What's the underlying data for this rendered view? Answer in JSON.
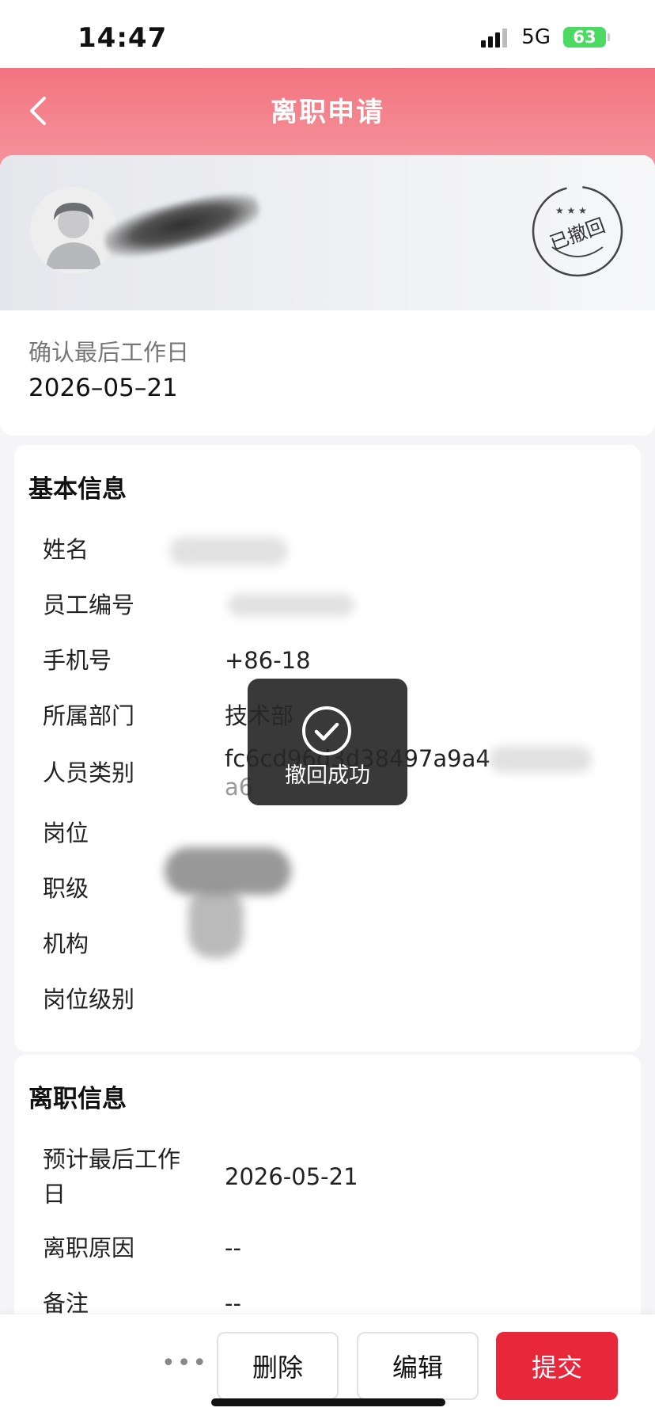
{
  "status_bar": {
    "time": "14:47",
    "network": "5G",
    "battery": "63"
  },
  "header": {
    "title": "离职申请"
  },
  "profile": {
    "stamp_text": "已撤回",
    "last_day_label": "确认最后工作日",
    "last_day_value": "2026–05–21"
  },
  "basic_info": {
    "title": "基本信息",
    "rows": [
      {
        "label": "姓名",
        "value": ""
      },
      {
        "label": "员工编号",
        "value": ""
      },
      {
        "label": "手机号",
        "value": "+86-18"
      },
      {
        "label": "所属部门",
        "value": "技术部"
      },
      {
        "label": "人员类别",
        "value": "fc6cd96d3d38497a9a4",
        "value_line2": "a6"
      },
      {
        "label": "岗位",
        "value": ""
      },
      {
        "label": "职级",
        "value": ""
      },
      {
        "label": "机构",
        "value": ""
      },
      {
        "label": "岗位级别",
        "value": ""
      }
    ]
  },
  "resign_info": {
    "title": "离职信息",
    "rows": [
      {
        "label": "预计最后工作",
        "label_line2": "日",
        "value": "2026-05-21"
      },
      {
        "label": "离职原因",
        "value": "--"
      },
      {
        "label": "备注",
        "value": "--"
      }
    ]
  },
  "toast": {
    "text": "撤回成功"
  },
  "bottom_bar": {
    "more": "•••",
    "delete_label": "删除",
    "edit_label": "编辑",
    "submit_label": "提交"
  },
  "colors": {
    "header_top": "#f2737f",
    "submit_red": "#e8273a",
    "battery_green": "#4cd964"
  },
  "icons": [
    "back-arrow-icon",
    "avatar-placeholder-icon",
    "check-circle-icon",
    "more-icon"
  ]
}
